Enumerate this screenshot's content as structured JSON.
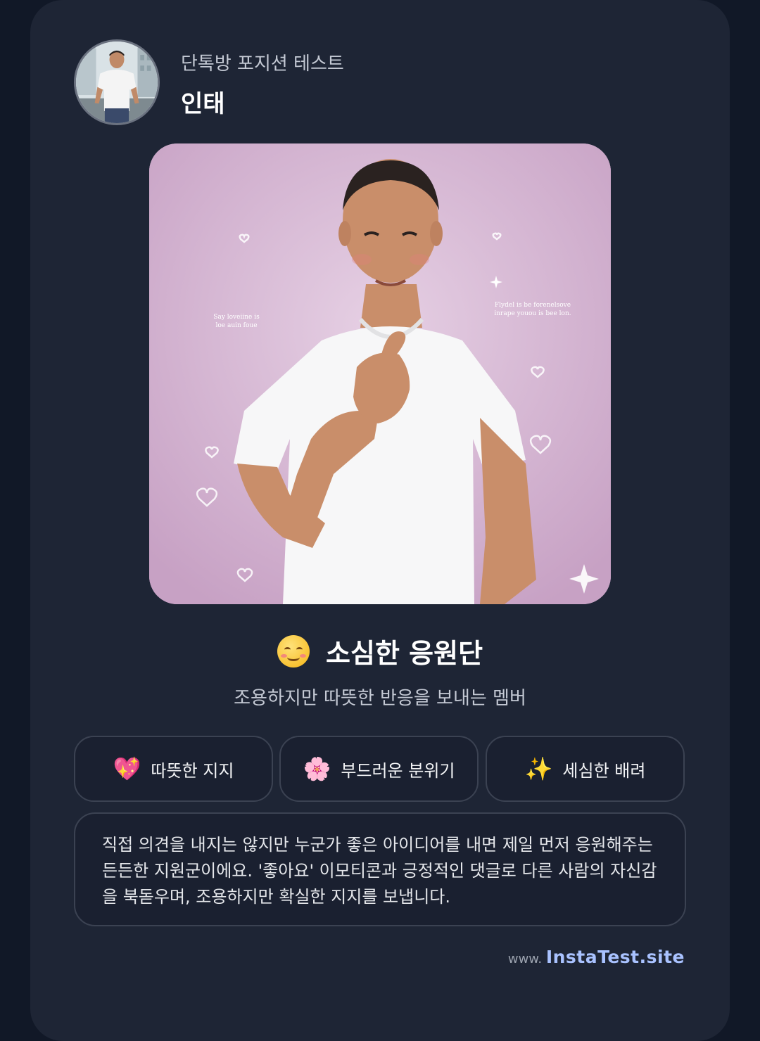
{
  "header": {
    "subtitle": "단톡방 포지션 테스트",
    "name": "인태"
  },
  "hero": {
    "text_left": [
      "Say loveiine is",
      "loe auin foue"
    ],
    "text_right": [
      "Flydel is be forenelsove",
      "inrape youou is bee lon."
    ]
  },
  "result": {
    "emoji": "smiling-face-icon",
    "title": "소심한 응원단",
    "subtitle": "조용하지만 따뜻한 반응을 보내는 멤버"
  },
  "traits": [
    {
      "icon": "sparkling-heart-icon",
      "glyph": "💖",
      "label": "따뜻한 지지"
    },
    {
      "icon": "cherry-blossom-icon",
      "glyph": "🌸",
      "label": "부드러운 분위기"
    },
    {
      "icon": "sparkles-icon",
      "glyph": "✨",
      "label": "세심한 배려"
    }
  ],
  "description": "직접 의견을 내지는 않지만 누군가 좋은 아이디어를 내면 제일 먼저 응원해주는 든든한 지원군이에요. '좋아요' 이모티콘과 긍정적인 댓글로 다른 사람의 자신감을 북돋우며, 조용하지만 확실한 지지를 보냅니다.",
  "footer": {
    "prefix": "www.",
    "site": "InstaTest.site"
  },
  "colors": {
    "background": "#111827",
    "card": "#1e2535",
    "accent_link": "#a9c2ff",
    "hero_bg": "#d7b9d6"
  }
}
